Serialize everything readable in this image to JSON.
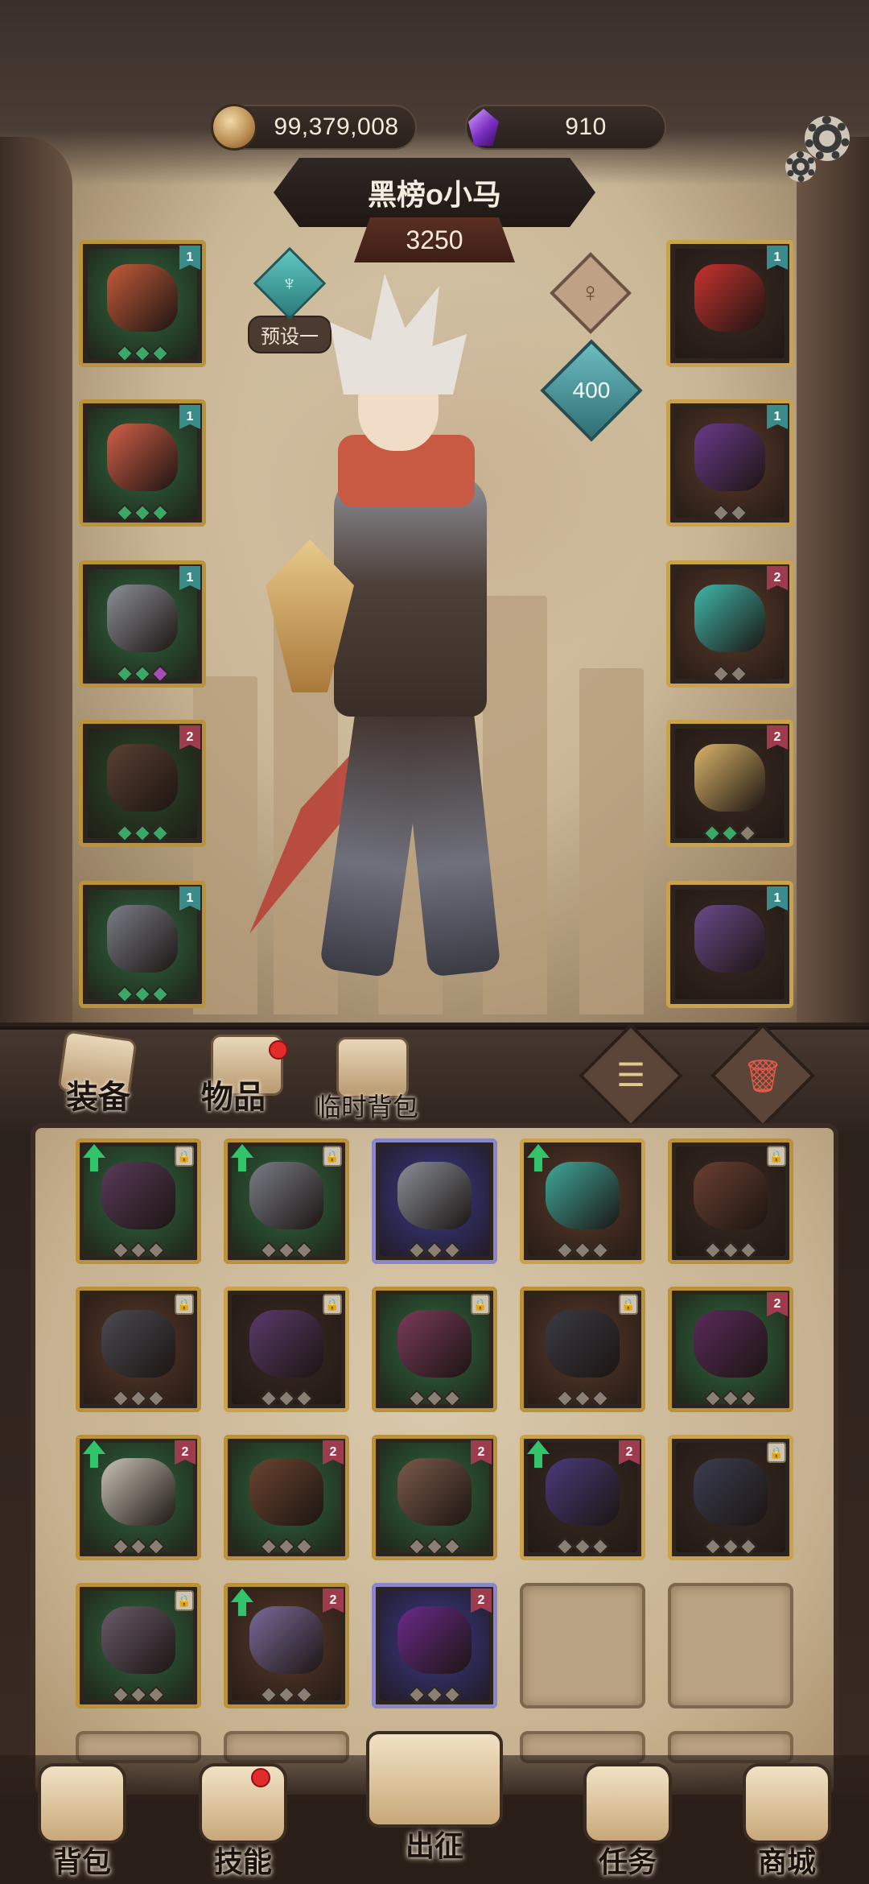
{
  "header": {
    "gold": "99,379,008",
    "gems": "910",
    "player_name": "黑榜o小马",
    "power": "3250",
    "preset_label": "预设一",
    "level": "400",
    "icons": {
      "gold": "coin-icon",
      "gems": "purple-gem-icon",
      "settings": "gear-icon",
      "gender": "female-icon"
    }
  },
  "equipment": {
    "left": [
      {
        "name": "feather-helmet",
        "rank": "1",
        "frame": "#b9923a",
        "bg": "#2f6a3f",
        "item": "#c45a3a",
        "gems": [
          "#3aa866",
          "#3aa866",
          "#3aa866"
        ]
      },
      {
        "name": "red-scarf-armor",
        "rank": "1",
        "frame": "#b9923a",
        "bg": "#2f6a3f",
        "item": "#d25e48",
        "gems": [
          "#3aa866",
          "#3aa866",
          "#3aa866"
        ]
      },
      {
        "name": "gold-gauntlet",
        "rank": "1",
        "frame": "#b9923a",
        "bg": "#2f6a3f",
        "item": "#8c8f98",
        "gems": [
          "#3aa866",
          "#3aa866",
          "#a54fb6"
        ]
      },
      {
        "name": "leather-pants",
        "rank": "2",
        "frame": "#b9923a",
        "bg": "#2a4a2a",
        "item": "#5a4032",
        "gems": [
          "#3aa866",
          "#3aa866",
          "#3aa866"
        ]
      },
      {
        "name": "armored-boots",
        "rank": "1",
        "frame": "#b9923a",
        "bg": "#2f6a3f",
        "item": "#7a7d88",
        "gems": [
          "#3aa866",
          "#3aa866",
          "#3aa866"
        ]
      }
    ],
    "right": [
      {
        "name": "ruby-amulet",
        "rank": "1",
        "frame": "#c9a24a",
        "bg": "#3a2a22",
        "item": "#c8322f",
        "gems": []
      },
      {
        "name": "purple-ring",
        "rank": "1",
        "frame": "#c9a24a",
        "bg": "#5a3a2a",
        "item": "#6a3a8a",
        "gems": [
          "#8a7f73",
          "#8a7f73"
        ]
      },
      {
        "name": "teal-gem-ring",
        "rank": "2",
        "frame": "#c9a24a",
        "bg": "#5a3a2a",
        "item": "#3fb6a8",
        "gems": [
          "#8a7f73",
          "#8a7f73"
        ]
      },
      {
        "name": "gold-trinket",
        "rank": "2",
        "frame": "#c9a24a",
        "bg": "#3a2a22",
        "item": "#d9b46a",
        "gems": [
          "#3aa866",
          "#3aa866",
          "#8a7f73"
        ]
      },
      {
        "name": "purple-bow",
        "rank": "1",
        "frame": "#c9a24a",
        "bg": "#3a2a22",
        "item": "#6a4a8a",
        "gems": []
      }
    ]
  },
  "tabs": {
    "equipment": "装备",
    "items": "物品",
    "temp_bag": "临时背包"
  },
  "inventory": [
    {
      "name": "chain-gloves",
      "bg": "#2f6a3f",
      "frame": "#b9923a",
      "item": "#5a3a5a",
      "up": true,
      "lock": true,
      "rank": ""
    },
    {
      "name": "steel-chest",
      "bg": "#2f6a3f",
      "frame": "#b9923a",
      "item": "#7a7d88",
      "up": true,
      "lock": true,
      "rank": ""
    },
    {
      "name": "ruby-ring",
      "bg": "#3a3a8a",
      "frame": "#8a86c9",
      "item": "#8a8f98",
      "up": false,
      "lock": false,
      "rank": ""
    },
    {
      "name": "dragon-helm",
      "bg": "#5a3a2a",
      "frame": "#c9a24a",
      "item": "#3fa89a",
      "up": true,
      "lock": false,
      "rank": ""
    },
    {
      "name": "wooden-bow",
      "bg": "#3a2a22",
      "frame": "#b9923a",
      "item": "#6a4030",
      "up": false,
      "lock": true,
      "rank": ""
    },
    {
      "name": "chain-ring",
      "bg": "#5a3a2a",
      "frame": "#b9923a",
      "item": "#4a4a52",
      "up": false,
      "lock": true,
      "rank": ""
    },
    {
      "name": "purple-boots",
      "bg": "#3a2a22",
      "frame": "#c9a24a",
      "item": "#5a3a6a",
      "up": false,
      "lock": true,
      "rank": ""
    },
    {
      "name": "tattered-robe",
      "bg": "#2f6a3f",
      "frame": "#b9923a",
      "item": "#7a3a5a",
      "up": false,
      "lock": true,
      "rank": ""
    },
    {
      "name": "iron-band",
      "bg": "#5a3a2a",
      "frame": "#b9923a",
      "item": "#3a3a44",
      "up": false,
      "lock": true,
      "rank": ""
    },
    {
      "name": "purple-boot-2",
      "bg": "#2f6a3f",
      "frame": "#b9923a",
      "item": "#5a2a5a",
      "up": false,
      "lock": false,
      "rank": "2"
    },
    {
      "name": "fur-bracer",
      "bg": "#2f6a3f",
      "frame": "#b9923a",
      "item": "#c8c2b6",
      "up": true,
      "lock": false,
      "rank": "2"
    },
    {
      "name": "leather-bracer",
      "bg": "#2f6a3f",
      "frame": "#b9923a",
      "item": "#6a4430",
      "up": false,
      "lock": false,
      "rank": "2"
    },
    {
      "name": "rope-boots",
      "bg": "#2f6a3f",
      "frame": "#b9923a",
      "item": "#7a5a4a",
      "up": false,
      "lock": false,
      "rank": "2"
    },
    {
      "name": "feather-quiver",
      "bg": "#3a2a22",
      "frame": "#c9a24a",
      "item": "#4a3a7a",
      "up": true,
      "lock": false,
      "rank": "2"
    },
    {
      "name": "steel-boots",
      "bg": "#3a2a22",
      "frame": "#c9a24a",
      "item": "#3a3e50",
      "up": false,
      "lock": true,
      "rank": ""
    },
    {
      "name": "dragon-skull",
      "bg": "#2f6a3f",
      "frame": "#b9923a",
      "item": "#6a5a6a",
      "up": false,
      "lock": true,
      "rank": ""
    },
    {
      "name": "crystal-necklace",
      "bg": "#5a3a2a",
      "frame": "#b9923a",
      "item": "#7a6a9a",
      "up": true,
      "lock": false,
      "rank": "2"
    },
    {
      "name": "void-gauntlet",
      "bg": "#3a3a8a",
      "frame": "#8a86c9",
      "item": "#6a2a8a",
      "up": false,
      "lock": false,
      "rank": "2"
    }
  ],
  "nav": {
    "bag": "背包",
    "skills": "技能",
    "expedition": "出征",
    "quests": "任务",
    "shop": "商城"
  },
  "colors": {
    "gold_frame": "#b9923a",
    "notification": "#e22b2b",
    "upgrade_arrow": "#31c46b"
  }
}
